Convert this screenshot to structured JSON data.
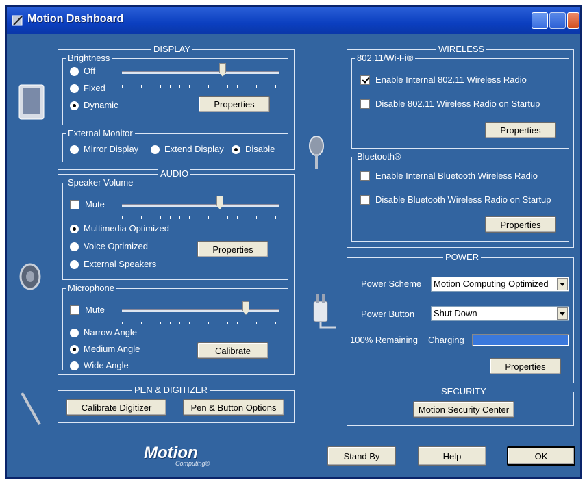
{
  "window": {
    "title": "Motion Dashboard"
  },
  "display": {
    "title": "DISPLAY",
    "brightness": {
      "title": "Brightness",
      "options": [
        "Off",
        "Fixed",
        "Dynamic"
      ],
      "selected": "Dynamic",
      "slider_value": 0.6,
      "properties_label": "Properties"
    },
    "external_monitor": {
      "title": "External Monitor",
      "options": [
        "Mirror Display",
        "Extend Display",
        "Disable"
      ],
      "selected": "Disable"
    }
  },
  "audio": {
    "title": "AUDIO",
    "speaker": {
      "title": "Speaker Volume",
      "mute_label": "Mute",
      "mute_checked": false,
      "slider_value": 0.6,
      "options": [
        "Multimedia Optimized",
        "Voice Optimized",
        "External Speakers"
      ],
      "selected": "Multimedia Optimized",
      "properties_label": "Properties"
    },
    "microphone": {
      "title": "Microphone",
      "mute_label": "Mute",
      "mute_checked": false,
      "slider_value": 0.8,
      "options": [
        "Narrow Angle",
        "Medium Angle",
        "Wide Angle"
      ],
      "selected": "Medium Angle",
      "calibrate_label": "Calibrate"
    }
  },
  "pen": {
    "title": "PEN & DIGITIZER",
    "calibrate_label": "Calibrate Digitizer",
    "options_label": "Pen & Button Options"
  },
  "wireless": {
    "title": "WIRELESS",
    "wifi": {
      "title": "802.11/Wi-Fi®",
      "enable_label": "Enable Internal 802.11 Wireless Radio",
      "enable_checked": true,
      "disable_label": "Disable 802.11 Wireless Radio on Startup",
      "disable_checked": false,
      "properties_label": "Properties"
    },
    "bluetooth": {
      "title": "Bluetooth®",
      "enable_label": "Enable Internal Bluetooth Wireless Radio",
      "enable_checked": false,
      "disable_label": "Disable Bluetooth Wireless Radio on Startup",
      "disable_checked": false,
      "properties_label": "Properties"
    }
  },
  "power": {
    "title": "POWER",
    "scheme_label": "Power Scheme",
    "scheme_value": "Motion Computing Optimized",
    "button_label": "Power Button",
    "button_value": "Shut Down",
    "remaining_label": "100% Remaining",
    "status_label": "Charging",
    "battery_level": 1.0,
    "properties_label": "Properties"
  },
  "security": {
    "title": "SECURITY",
    "center_label": "Motion Security Center"
  },
  "footer": {
    "logo_text": "Motion",
    "logo_subtext": "Computing®",
    "standby_label": "Stand By",
    "help_label": "Help",
    "ok_label": "OK"
  },
  "colors": {
    "background": "#3264a0",
    "titlebar": "#0b3fc0",
    "button": "#ece9d8"
  },
  "icons": [
    "tablet-icon",
    "speaker-icon",
    "pen-icon",
    "wireless-icon",
    "power-plug-icon"
  ]
}
